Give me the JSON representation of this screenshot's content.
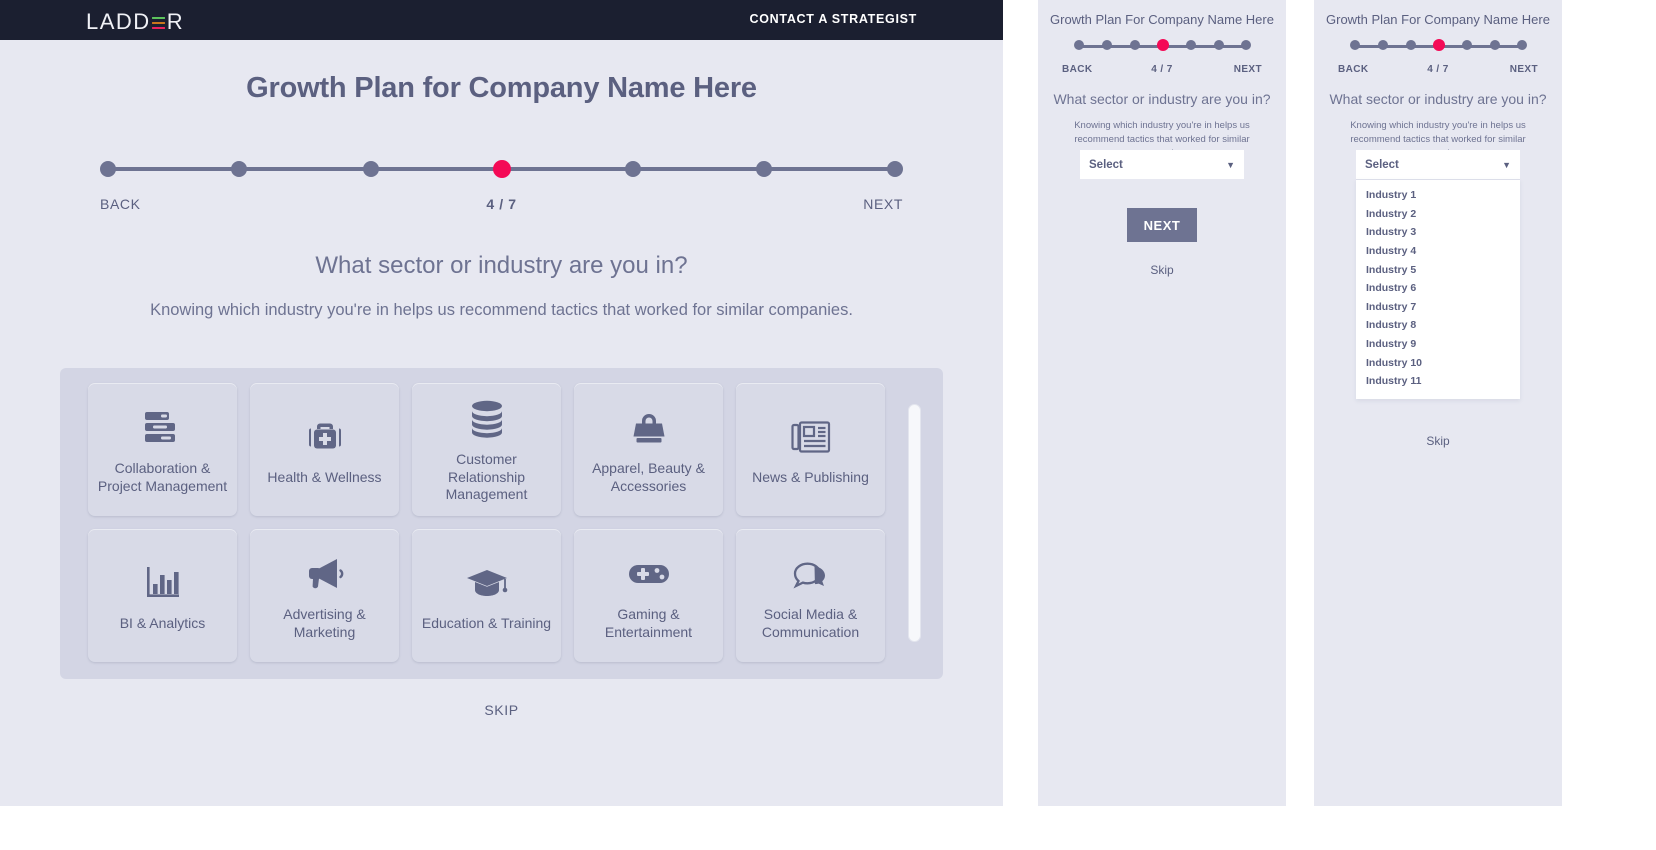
{
  "brand": {
    "part1": "LADD",
    "part2": "R",
    "icon": "ladder-logo"
  },
  "nav": {
    "cta": "CONTACT A STRATEGIST"
  },
  "desktop": {
    "page_title": "Growth Plan for Company Name Here",
    "progress": {
      "total": 7,
      "current": 4,
      "counter": "4 / 7",
      "back": "BACK",
      "next": "NEXT"
    },
    "question": "What sector or industry are you in?",
    "subtext": "Knowing which industry you're in helps us recommend tactics that worked for similar companies.",
    "skip": "SKIP",
    "cards": [
      {
        "label": "Collaboration & Project Management",
        "icon": "task-list-icon"
      },
      {
        "label": "Health & Wellness",
        "icon": "medical-bag-icon"
      },
      {
        "label": "Customer Relationship Management",
        "icon": "database-icon"
      },
      {
        "label": "Apparel, Beauty & Accessories",
        "icon": "handbag-icon"
      },
      {
        "label": "News & Publishing",
        "icon": "newspaper-icon"
      },
      {
        "label": "BI & Analytics",
        "icon": "bar-chart-icon"
      },
      {
        "label": "Advertising & Marketing",
        "icon": "megaphone-icon"
      },
      {
        "label": "Education & Training",
        "icon": "graduation-cap-icon"
      },
      {
        "label": "Gaming & Entertainment",
        "icon": "gamepad-icon"
      },
      {
        "label": "Social Media & Communication",
        "icon": "speech-bubbles-icon"
      }
    ]
  },
  "mobile": {
    "title": "Growth Plan For Company Name Here",
    "progress": {
      "total": 7,
      "current": 4,
      "counter": "4 / 7",
      "back": "BACK",
      "next": "NEXT"
    },
    "question": "What sector or industry are you in?",
    "subtext": "Knowing which industry you're in helps us recommend tactics that worked for similar companies.",
    "select": {
      "value": "Select",
      "chevron": "▼"
    },
    "next_button": "NEXT",
    "skip": "Skip",
    "options": [
      "Industry 1",
      "Industry 2",
      "Industry 3",
      "Industry 4",
      "Industry 5",
      "Industry 6",
      "Industry 7",
      "Industry 8",
      "Industry 9",
      "Industry 10",
      "Industry 11"
    ]
  },
  "colors": {
    "navbar": "#1b1f30",
    "page_bg": "#e7e8f1",
    "accent_pink": "#f40a56",
    "slate": "#6e7392",
    "grid_panel": "#d3d5e4",
    "card_bg": "#d8dae7",
    "logo_green": "#5cc25c",
    "logo_orange": "#c9761d",
    "logo_pink": "#e8225f"
  }
}
